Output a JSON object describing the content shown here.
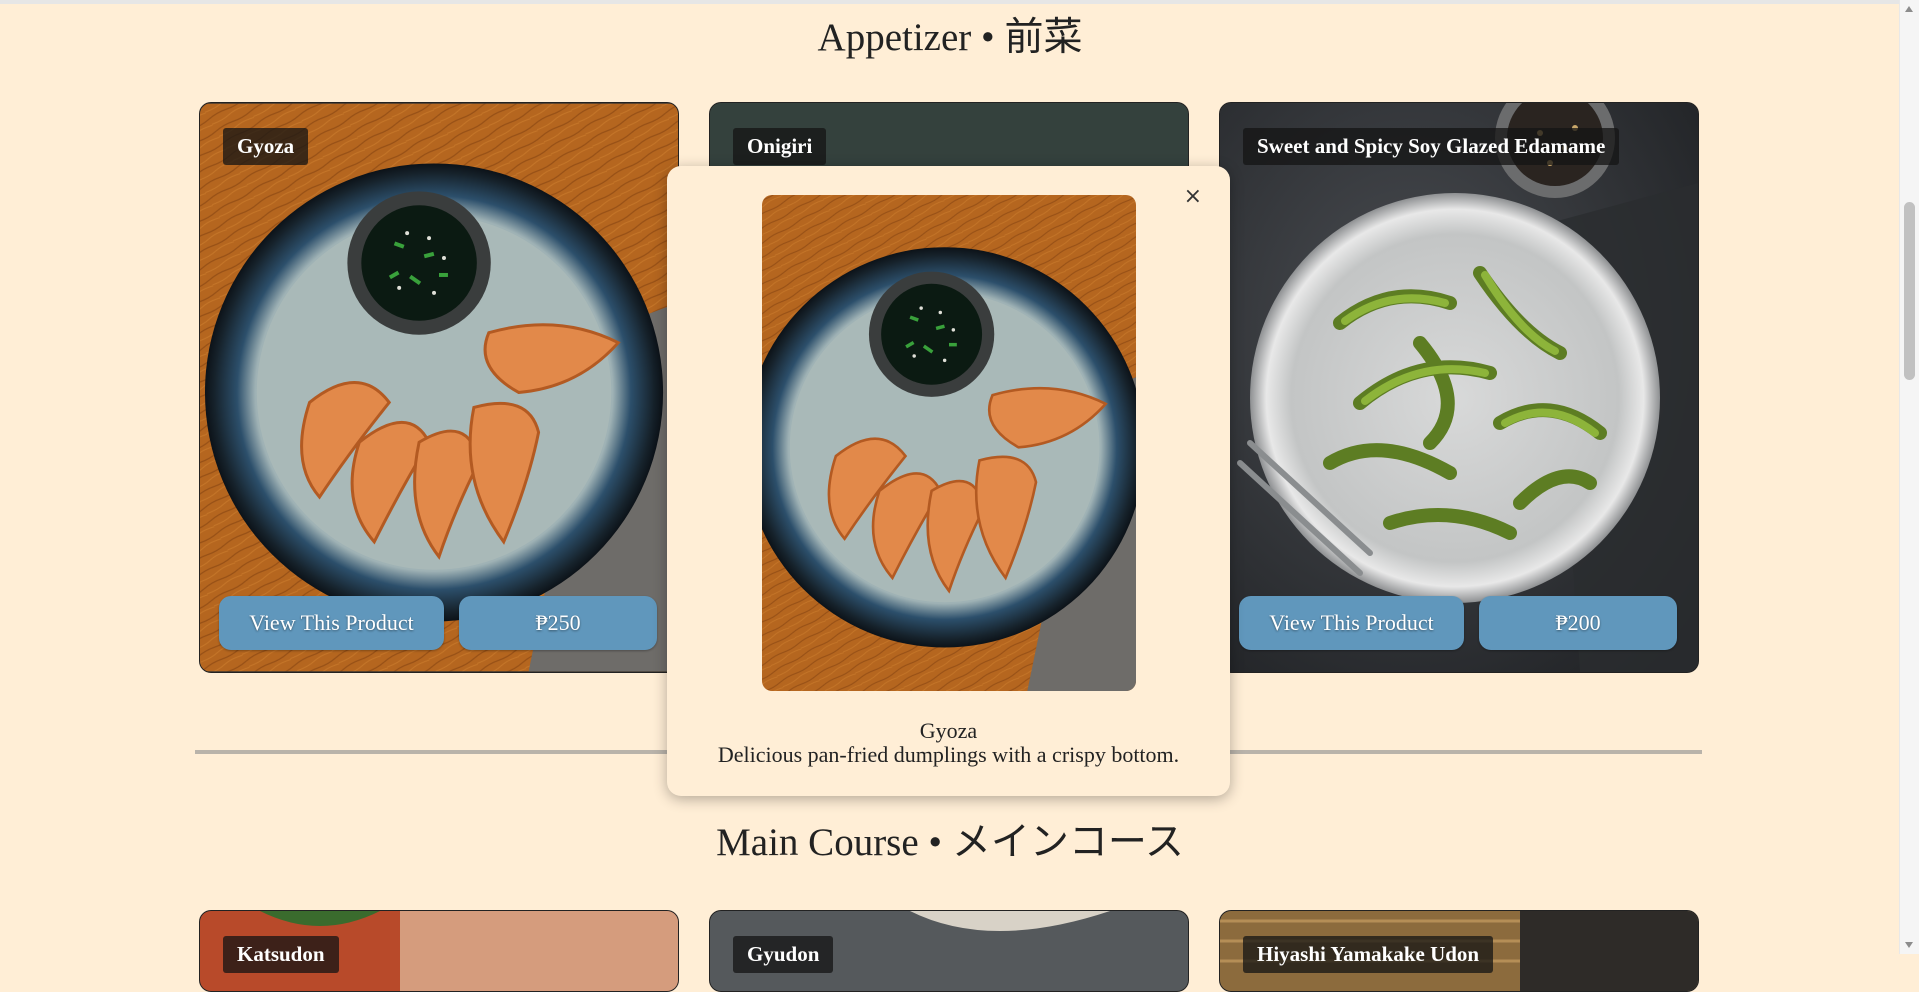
{
  "appetizer_title": "Appetizer • 前菜",
  "main_course_title": "Main Course • メインコース",
  "cards": [
    {
      "name": "Gyoza",
      "view_label": "View This Product",
      "price": "₱250"
    },
    {
      "name": "Onigiri"
    },
    {
      "name": "Sweet and Spicy Soy Glazed Edamame",
      "view_label": "View This Product",
      "price": "₱200"
    }
  ],
  "bottom_cards": [
    {
      "name": "Katsudon"
    },
    {
      "name": "Gyudon"
    },
    {
      "name": "Hiyashi Yamakake Udon"
    }
  ],
  "modal": {
    "close": "×",
    "name": "Gyoza",
    "description": "Delicious pan-fried dumplings with a crispy bottom."
  }
}
